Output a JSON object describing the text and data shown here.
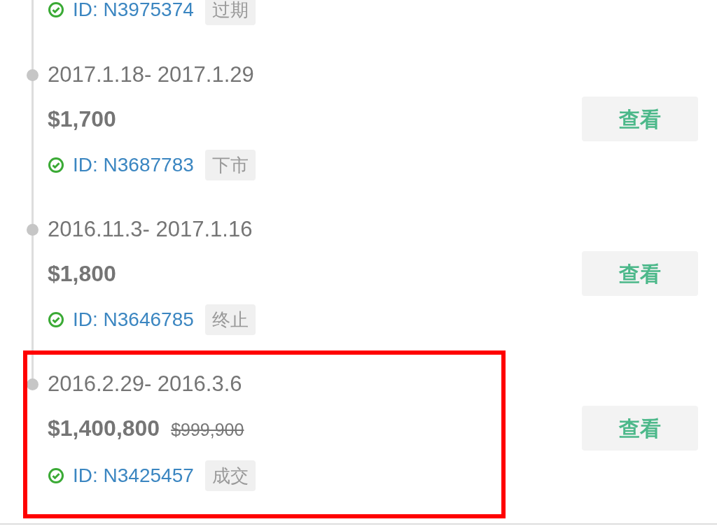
{
  "listings": [
    {
      "id": "ID: N3975374",
      "status": "过期"
    },
    {
      "dates": "2017.1.18- 2017.1.29",
      "price": "$1,700",
      "id": "ID: N3687783",
      "status": "下市",
      "button": "查看",
      "highlighted": false
    },
    {
      "dates": "2016.11.3- 2017.1.16",
      "price": "$1,800",
      "id": "ID: N3646785",
      "status": "终止",
      "button": "查看",
      "highlighted": false
    },
    {
      "dates": "2016.2.29- 2016.3.6",
      "price": "$1,400,800",
      "original_price": "$999,900",
      "id": "ID: N3425457",
      "status": "成交",
      "button": "查看",
      "highlighted": true
    }
  ]
}
